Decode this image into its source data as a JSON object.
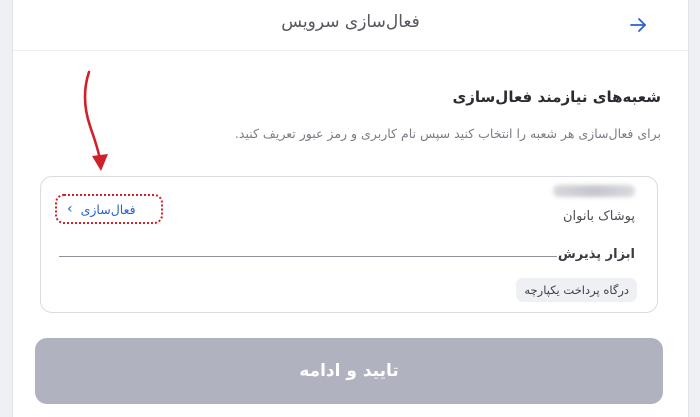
{
  "header": {
    "title": "فعال‌سازی سرویس",
    "back_icon": "arrow-right-icon"
  },
  "section": {
    "title": "شعبه‌های نیازمند فعال‌سازی",
    "description": "برای فعال‌سازی هر شعبه را انتخاب کنید سپس نام کاربری و رمز عبور تعریف کنید."
  },
  "branch_card": {
    "branch_type": "پوشاک بانوان",
    "activate_label": "فعال‌سازی",
    "activate_icon": "chevron-left-icon",
    "tools_label": "ابزار پذیرش",
    "tools": [
      "درگاه پرداخت یکپارچه"
    ]
  },
  "footer": {
    "confirm_label": "تایید و ادامه"
  },
  "colors": {
    "accent": "#2b5fcf",
    "annotation_red": "#d0202a",
    "disabled_button": "#b0b2bf"
  }
}
